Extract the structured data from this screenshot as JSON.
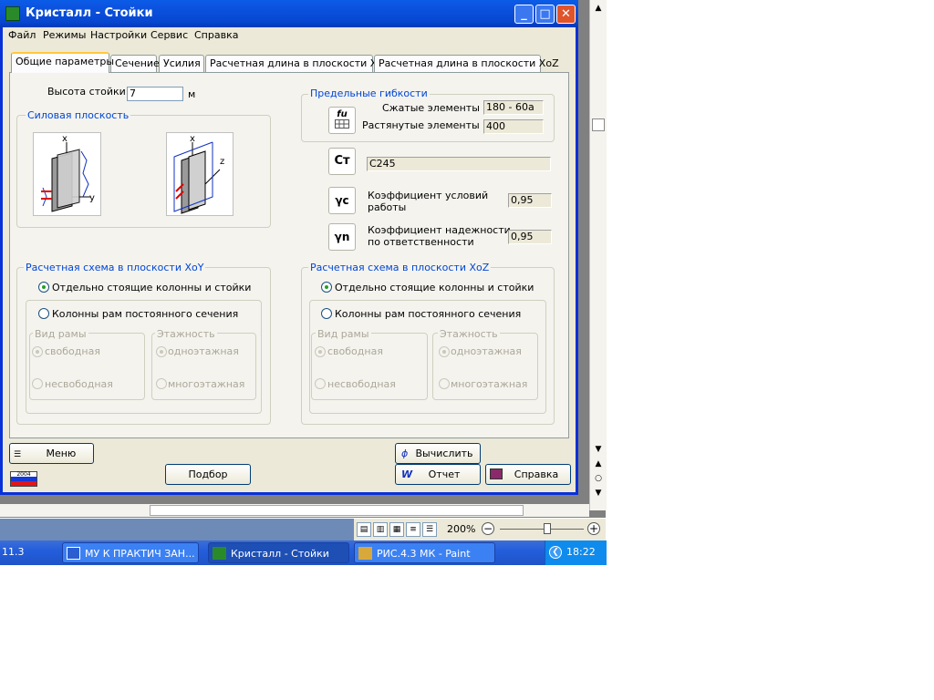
{
  "window": {
    "title": "Кристалл - Стойки",
    "min": "_",
    "max": "□",
    "close": "✕"
  },
  "menu": [
    "Файл",
    "Режимы",
    "Настройки",
    "Сервис",
    "Справка"
  ],
  "tabs": [
    "Общие параметры",
    "Сечение",
    "Усилия",
    "Расчетная длина в плоскости XoY",
    "Расчетная длина в плоскости XoZ"
  ],
  "height": {
    "label": "Высота стойки",
    "value": "7",
    "unit": "м"
  },
  "power_plane": {
    "title": "Силовая плоскость",
    "axis_x": "x",
    "axis_y": "y",
    "axis_z": "z"
  },
  "slenderness": {
    "title": "Предельные гибкости",
    "compressed_label": "Сжатые элементы",
    "compressed_value": "180 - 60a",
    "tensile_label": "Растянутые элементы",
    "tensile_value": "400",
    "icon_text": "fu"
  },
  "steel": {
    "icon_text": "Ст",
    "value": "С245"
  },
  "gamma_c": {
    "icon_text": "γc",
    "label": "Коэффициент условий работы",
    "value": "0,95"
  },
  "gamma_n": {
    "icon_text": "γn",
    "label": "Коэффициент надежности по ответственности",
    "value": "0,95"
  },
  "scheme_xoy": {
    "title": "Расчетная схема в плоскости XoY",
    "opt1": "Отдельно стоящие колонны и стойки",
    "opt2": "Колонны рам постоянного сечения",
    "frame_type": "Вид рамы",
    "free": "свободная",
    "nonfree": "несвободная",
    "floors": "Этажность",
    "single": "одноэтажная",
    "multi": "многоэтажная"
  },
  "scheme_xoz": {
    "title": "Расчетная схема в плоскости XoZ",
    "opt1": "Отдельно стоящие колонны и стойки",
    "opt2": "Колонны рам постоянного сечения",
    "frame_type": "Вид рамы",
    "free": "свободная",
    "nonfree": "несвободная",
    "floors": "Этажность",
    "single": "одноэтажная",
    "multi": "многоэтажная"
  },
  "buttons": {
    "menu": "Меню",
    "select": "Подбор",
    "calc": "Вычислить",
    "report": "Отчет",
    "help": "Справка"
  },
  "year_badge": "2004",
  "statusbar": {
    "zoom": "200%",
    "minus": "−",
    "plus": "+"
  },
  "taskbar": {
    "left_fragment": "11.3",
    "items": [
      "МУ К ПРАКТИЧ ЗАН...",
      "Кристалл - Стойки",
      "РИС.4.3 МК - Paint"
    ],
    "clock": "18:22"
  },
  "colors": {
    "accent": "#0046d5",
    "title_bar": "#0a5ce6",
    "taskbar": "#245edb"
  }
}
